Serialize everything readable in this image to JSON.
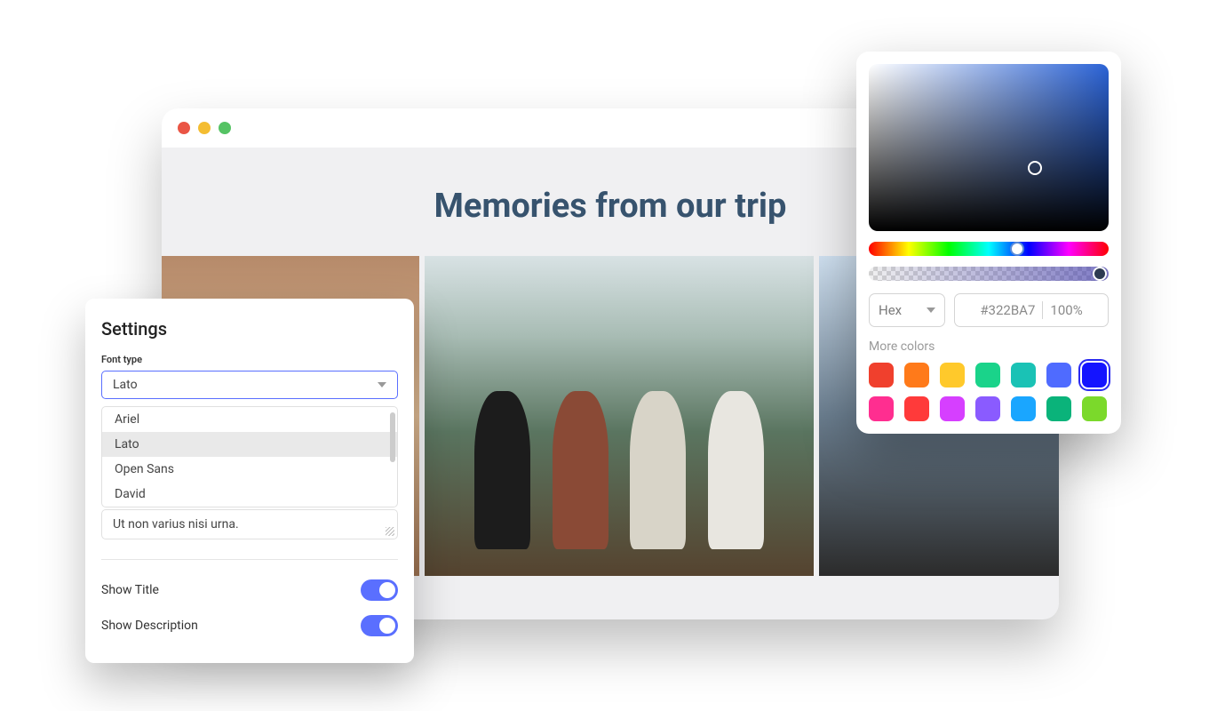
{
  "browser": {
    "title": "Memories from our trip"
  },
  "settings": {
    "heading": "Settings",
    "font_type_label": "Font type",
    "selected_font": "Lato",
    "font_options": [
      "Ariel",
      "Lato",
      "Open Sans",
      "David"
    ],
    "textarea_value": "Ut non varius nisi urna.",
    "show_title_label": "Show Title",
    "show_description_label": "Show Description",
    "show_title_on": true,
    "show_description_on": true
  },
  "picker": {
    "format": "Hex",
    "hex_value": "#322BA7",
    "opacity": "100%",
    "more_colors_label": "More colors",
    "swatches": [
      {
        "hex": "#f0402d"
      },
      {
        "hex": "#ff7a1a"
      },
      {
        "hex": "#ffc92b"
      },
      {
        "hex": "#1ad38a"
      },
      {
        "hex": "#1ac2b5"
      },
      {
        "hex": "#4f6bff"
      },
      {
        "hex": "#1414ff",
        "selected": true
      },
      {
        "hex": "#ff2e90"
      },
      {
        "hex": "#ff3a3a"
      },
      {
        "hex": "#d63fff"
      },
      {
        "hex": "#8a5bff"
      },
      {
        "hex": "#1aa6ff"
      },
      {
        "hex": "#0ab37a"
      },
      {
        "hex": "#7bd92b"
      }
    ]
  }
}
